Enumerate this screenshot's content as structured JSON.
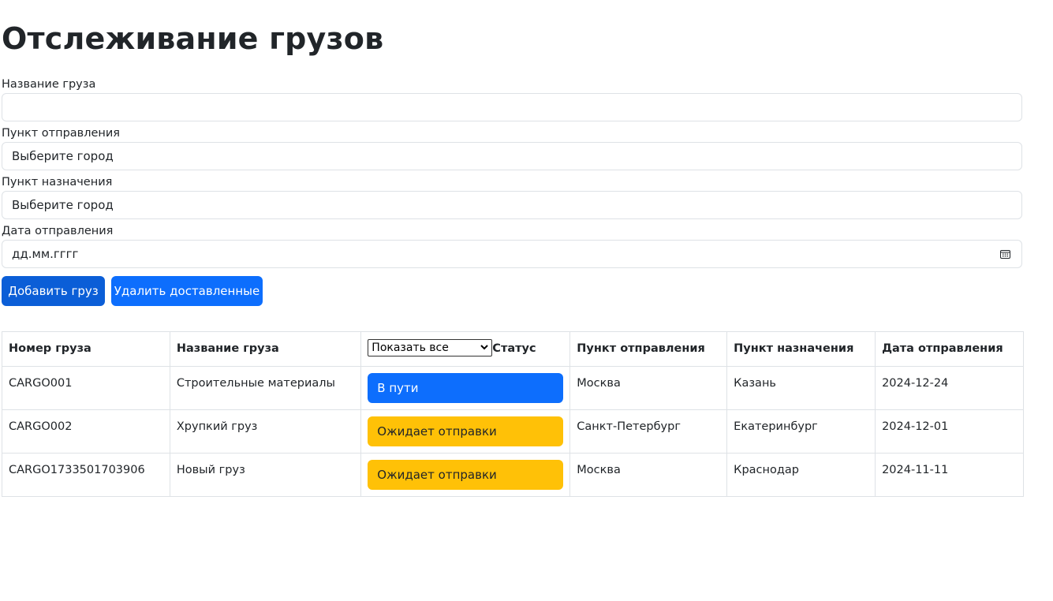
{
  "page": {
    "title": "Отслеживание грузов"
  },
  "form": {
    "cargo_name_label": "Название груза",
    "cargo_name_value": "",
    "origin_label": "Пункт отправления",
    "origin_value": "Выберите город",
    "destination_label": "Пункт назначения",
    "destination_value": "Выберите город",
    "date_label": "Дата отправления",
    "date_placeholder": "дд.мм.гггг",
    "add_button": "Добавить груз",
    "delete_button": "Удалить доставленные"
  },
  "table": {
    "headers": {
      "number": "Номер груза",
      "name": "Название груза",
      "status_filter": "Показать все",
      "status": "Статус",
      "origin": "Пункт отправления",
      "destination": "Пункт назначения",
      "date": "Дата отправления"
    },
    "rows": [
      {
        "number": "CARGO001",
        "name": "Строительные материалы",
        "status": "В пути",
        "origin": "Москва",
        "destination": "Казань",
        "date": "2024-12-24"
      },
      {
        "number": "CARGO002",
        "name": "Хрупкий груз",
        "status": "Ожидает отправки",
        "origin": "Санкт-Петербург",
        "destination": "Екатеринбург",
        "date": "2024-12-01"
      },
      {
        "number": "CARGO1733501703906",
        "name": "Новый груз",
        "status": "Ожидает отправки",
        "origin": "Москва",
        "destination": "Краснодар",
        "date": "2024-11-11"
      }
    ]
  },
  "colors": {
    "in_transit": "#0d6efd",
    "awaiting": "#ffc107",
    "primary_button": "#0d6efd",
    "primary_button_active": "#0b5ed7"
  },
  "icons": {
    "date_picker": "calendar-icon",
    "filter_dropdown": "chevron-down-icon"
  }
}
